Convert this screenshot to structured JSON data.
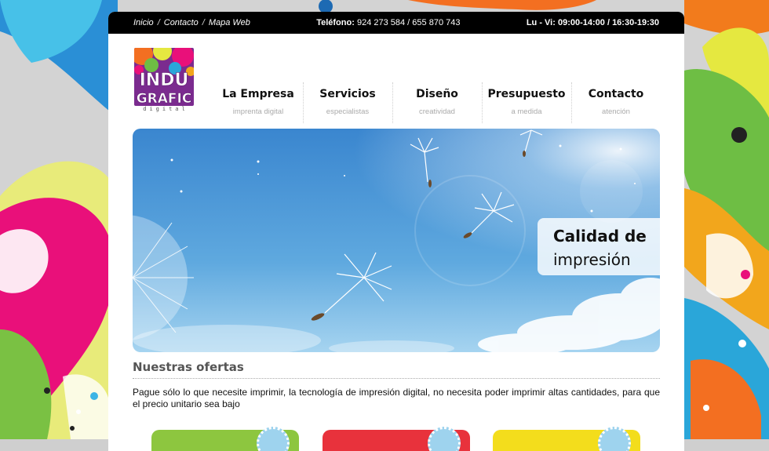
{
  "topbar": {
    "breadcrumbs": [
      "Inicio",
      "Contacto",
      "Mapa Web"
    ],
    "separator": "/",
    "phone_label": "Teléfono:",
    "phone_numbers": "924 273 584 / 655 870 743",
    "hours_label": "Lu - Vi:",
    "hours_value": "09:00-14:00 / 16:30-19:30"
  },
  "logo": {
    "line1": "INDU",
    "line2": "GRAFIC",
    "line3": "digital"
  },
  "nav": [
    {
      "label": "La Empresa",
      "sub": "imprenta digital"
    },
    {
      "label": "Servicios",
      "sub": "especialistas"
    },
    {
      "label": "Diseño",
      "sub": "creatividad"
    },
    {
      "label": "Presupuesto",
      "sub": "a medida"
    },
    {
      "label": "Contacto",
      "sub": "atención"
    }
  ],
  "banner": {
    "caption_line1": "Calidad de",
    "caption_line2": "impresión"
  },
  "offers": {
    "title": "Nuestras ofertas",
    "text": "Pague sólo lo que necesite imprimir, la tecnología de impresión digital, no necesita poder imprimir altas cantidades, para que el precio unitario sea bajo",
    "cards": [
      {
        "color": "#8dc63f"
      },
      {
        "color": "#e8323c"
      },
      {
        "color": "#f3dd1c"
      }
    ]
  },
  "colors": {
    "topbar": "#000000",
    "page": "#ffffff",
    "sky_top": "#3f8fd2",
    "sky_bottom": "#9fd0ee"
  }
}
